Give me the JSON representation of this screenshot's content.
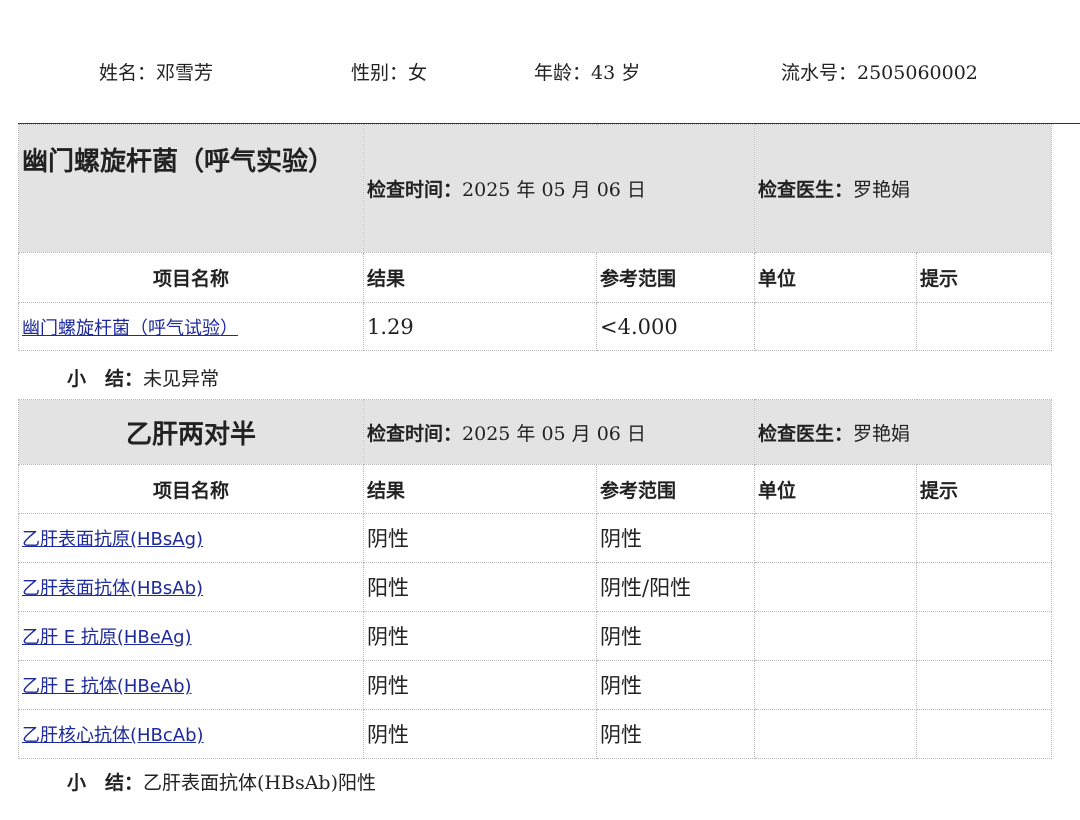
{
  "patient": {
    "name": "姓名：邓雪芳",
    "gender": "性别：女",
    "age": "年龄：43 岁",
    "serial": "流水号：2505060002"
  },
  "sections": [
    {
      "title": "幽门螺旋杆菌（呼气实验）",
      "time_label": "检查时间：",
      "time_value": "2025 年 05 月 06 日",
      "doctor_label": "检查医生：",
      "doctor_value": "罗艳娟",
      "columns": [
        "项目名称",
        "结果",
        "参考范围",
        "单位",
        "提示"
      ],
      "rows": [
        {
          "item": "幽门螺旋杆菌（呼气试验）",
          "result": "1.29",
          "range": "<4.000",
          "unit": "",
          "hint": ""
        }
      ],
      "summary_label": "小　结：",
      "summary_value": "未见异常"
    },
    {
      "title": "乙肝两对半",
      "time_label": "检查时间：",
      "time_value": "2025 年 05 月 06 日",
      "doctor_label": "检查医生：",
      "doctor_value": "罗艳娟",
      "columns": [
        "项目名称",
        "结果",
        "参考范围",
        "单位",
        "提示"
      ],
      "rows": [
        {
          "item": "乙肝表面抗原(HBsAg)",
          "result": "阴性",
          "range": "阴性",
          "unit": "",
          "hint": ""
        },
        {
          "item": "乙肝表面抗体(HBsAb)",
          "result": "阳性",
          "range": "阴性/阳性",
          "unit": "",
          "hint": ""
        },
        {
          "item": "乙肝 E 抗原(HBeAg)",
          "result": "阴性",
          "range": "阴性",
          "unit": "",
          "hint": ""
        },
        {
          "item": "乙肝 E 抗体(HBeAb)",
          "result": "阴性",
          "range": "阴性",
          "unit": "",
          "hint": ""
        },
        {
          "item": "乙肝核心抗体(HBcAb)",
          "result": "阴性",
          "range": "阴性",
          "unit": "",
          "hint": ""
        }
      ],
      "summary_label": "小　结：",
      "summary_value": "乙肝表面抗体(HBsAb)阳性"
    }
  ],
  "colors": {
    "header_bg": "#e3e3e3",
    "link": "#1d2a9c",
    "grid": "#b5b5b5"
  }
}
